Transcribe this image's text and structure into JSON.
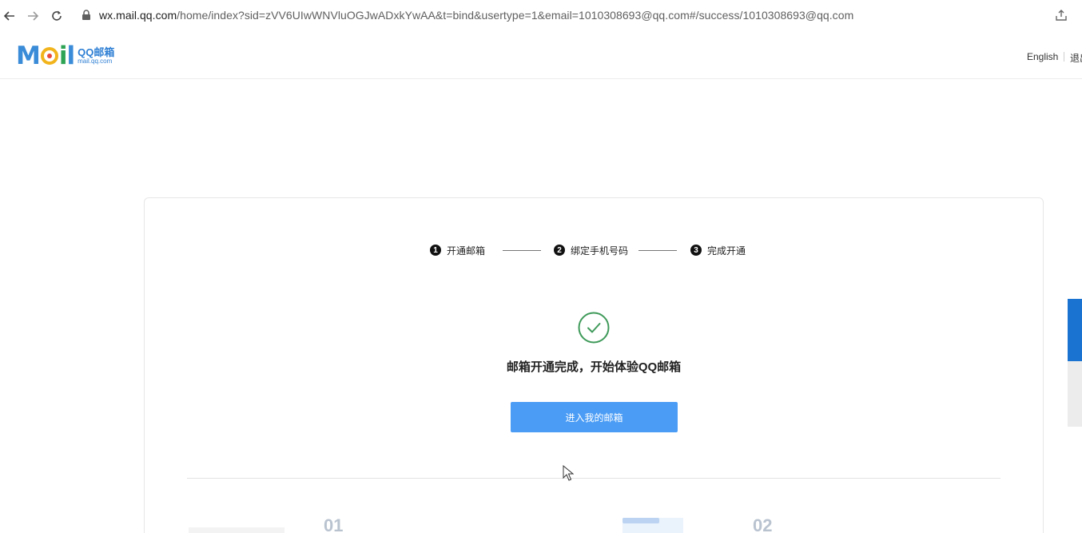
{
  "browser": {
    "url_host": "wx.mail.qq.com",
    "url_path": "/home/index?sid=zVV6UIwWNVluOGJwADxkYwAA&t=bind&usertype=1&email=1010308693@qq.com#/success/1010308693@qq.com"
  },
  "header": {
    "logo_word_m": "M",
    "logo_word_i": "i",
    "logo_word_l": "l",
    "logo_sub_cn": "QQ邮箱",
    "logo_sub_en": "mail.qq.com",
    "lang_label": "English",
    "logout_label": "退出"
  },
  "steps": [
    {
      "num": "1",
      "label": "开通邮箱"
    },
    {
      "num": "2",
      "label": "绑定手机号码"
    },
    {
      "num": "3",
      "label": "完成开通"
    }
  ],
  "success": {
    "title": "邮箱开通完成，开始体验QQ邮箱",
    "button_label": "进入我的邮箱"
  },
  "features": [
    {
      "num": "01"
    },
    {
      "num": "02"
    }
  ],
  "colors": {
    "accent": "#4a9cf5",
    "check": "#3f9a5a",
    "side_blue": "#1a73d1"
  }
}
